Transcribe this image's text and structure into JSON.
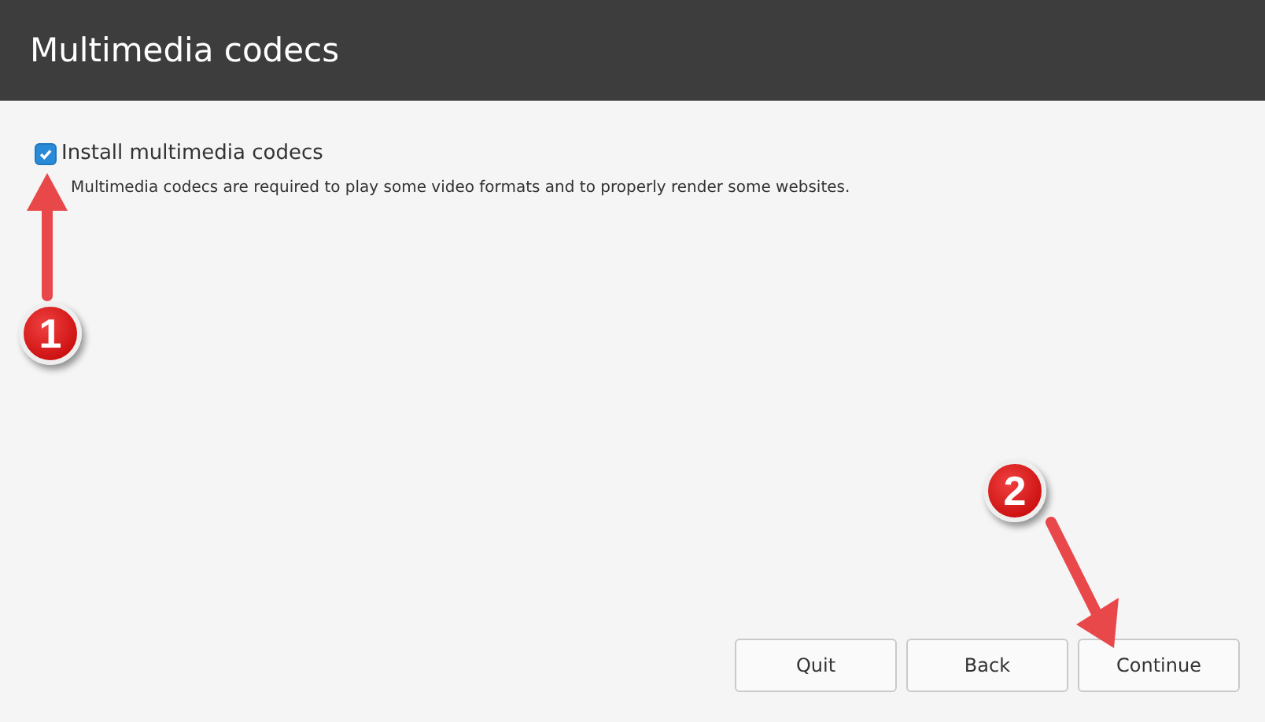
{
  "window": {
    "title": "Multimedia codecs"
  },
  "option": {
    "label": "Install multimedia codecs",
    "checked": true,
    "description": "Multimedia codecs are required to play some video formats and to properly render some websites."
  },
  "buttons": [
    "Quit",
    "Back",
    "Continue"
  ],
  "annotations": [
    {
      "number": "1"
    },
    {
      "number": "2"
    }
  ]
}
